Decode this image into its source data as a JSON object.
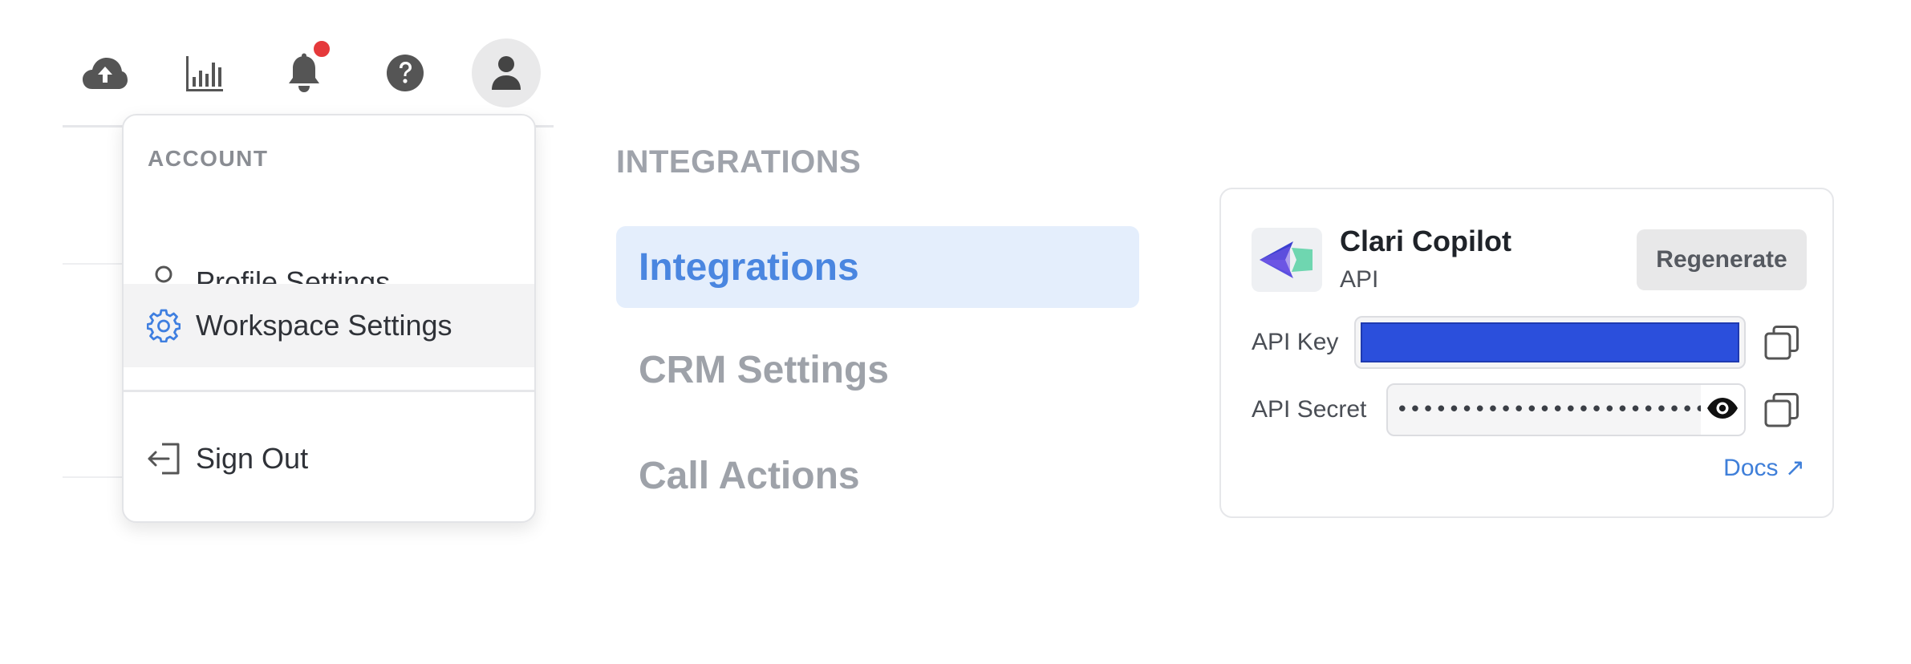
{
  "topbar": {
    "icons": [
      "cloud-upload-icon",
      "bar-chart-icon",
      "bell-icon",
      "help-icon",
      "user-avatar-icon"
    ],
    "notification_dot_color": "#e5393b"
  },
  "account_menu": {
    "header": "ACCOUNT",
    "items": [
      {
        "label": "Profile Settings",
        "icon": "user-outline-icon"
      },
      {
        "label": "Workspace Settings",
        "icon": "gear-icon",
        "active": true
      },
      {
        "label": "Sign Out",
        "icon": "sign-out-icon"
      }
    ]
  },
  "settings_nav": {
    "header": "INTEGRATIONS",
    "items": [
      {
        "label": "Integrations",
        "active": true
      },
      {
        "label": "CRM Settings"
      },
      {
        "label": "Call Actions"
      }
    ]
  },
  "integration_card": {
    "title": "Clari Copilot",
    "subtitle": "API",
    "regenerate_label": "Regenerate",
    "api_key_label": "API Key",
    "api_secret_label": "API Secret",
    "api_secret_value": "••••••••••••••••••••••••••••••",
    "docs_label": "Docs ↗",
    "colors": {
      "accent": "#4a86e0",
      "key_highlight": "#2b4fdc",
      "link": "#3f7fd9"
    }
  }
}
